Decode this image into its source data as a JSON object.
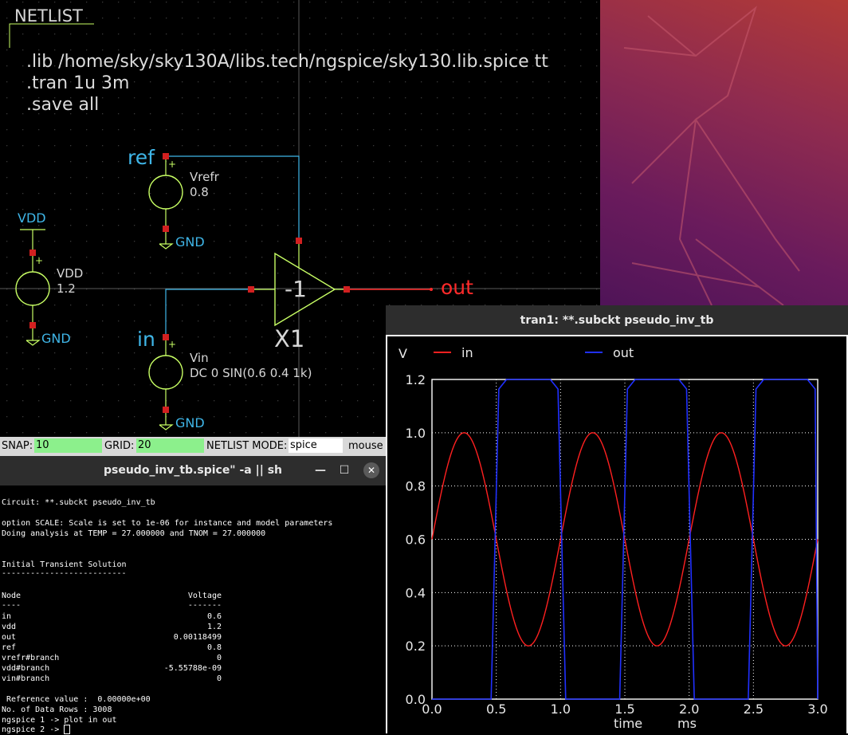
{
  "schematic": {
    "netlist_title": "NETLIST",
    "netlist_lines": [
      ".lib /home/sky/sky130A/libs.tech/ngspice/sky130.lib.spice tt",
      ".tran 1u 3m",
      ".save all"
    ],
    "vrefr": {
      "name": "Vrefr",
      "value": "0.8",
      "net": "ref",
      "gnd": "GND"
    },
    "vdd": {
      "label": "VDD",
      "name": "VDD",
      "value": "1.2",
      "gnd": "GND"
    },
    "vin": {
      "name": "Vin",
      "value": "DC 0 SIN(0.6 0.4 1k)",
      "net": "in",
      "gnd": "GND"
    },
    "inverter": {
      "gain": "-1",
      "instance": "X1"
    },
    "out_label": "out",
    "plus": "+"
  },
  "statusbar": {
    "snap_label": "SNAP:",
    "snap_value": "10",
    "grid_label": "GRID:",
    "grid_value": "20",
    "mode_label": "NETLIST MODE:",
    "mode_value": "spice",
    "mouse_label": "mouse"
  },
  "terminal": {
    "title": "pseudo_inv_tb.spice\" -a || sh",
    "minimize": "—",
    "maximize": "☐",
    "close": "✕",
    "lines": [
      "Circuit: **.subckt pseudo_inv_tb",
      "option SCALE: Scale is set to 1e-06 for instance and model parameters",
      "Doing analysis at TEMP = 27.000000 and TNOM = 27.000000",
      "Initial Transient Solution",
      "--------------------------",
      "Node",
      "----"
    ],
    "header_voltage": "Voltage",
    "header_dashes": "-------",
    "nodes": [
      {
        "node": "in",
        "value": "0.6"
      },
      {
        "node": "vdd",
        "value": "1.2"
      },
      {
        "node": "out",
        "value": "0.00118499"
      },
      {
        "node": "ref",
        "value": "0.8"
      },
      {
        "node": "vrefr#branch",
        "value": "0"
      },
      {
        "node": "vdd#branch",
        "value": "-5.55788e-09"
      },
      {
        "node": "vin#branch",
        "value": "0"
      }
    ],
    "footer": [
      " Reference value :  0.00000e+00",
      "No. of Data Rows : 3008",
      "ngspice 1 -> plot in out",
      "ngspice 2 -> "
    ]
  },
  "plot_window": {
    "title": "tran1: **.subckt pseudo_inv_tb",
    "ylabel": "V",
    "xlabel": "time",
    "xunit": "ms"
  },
  "chart_data": {
    "type": "line",
    "xlabel": "time",
    "xunit": "ms",
    "ylabel": "V",
    "xlim": [
      0,
      3.0
    ],
    "ylim": [
      0,
      1.2
    ],
    "xticks": [
      "0.0",
      "0.5",
      "1.0",
      "1.5",
      "2.0",
      "2.5",
      "3.0"
    ],
    "yticks": [
      "0.0",
      "0.2",
      "0.4",
      "0.6",
      "0.8",
      "1.0",
      "1.2"
    ],
    "grid": true,
    "legend": "top",
    "series": [
      {
        "name": "in",
        "color": "#ff2020",
        "function": "0.6 + 0.4*sin(2*pi*1k*t)",
        "offset": 0.6,
        "amplitude": 0.4,
        "frequency_khz": 1
      },
      {
        "name": "out",
        "color": "#2030ff",
        "high": 1.2,
        "low": 0.0,
        "rise_times_ms": [
          0.5,
          1.5,
          2.5
        ],
        "fall_times_ms": [
          1.0,
          2.0,
          3.0
        ]
      }
    ]
  },
  "colors": {
    "wire": "#c8ff64",
    "net_label": "#3fb6e8",
    "pin": "#d22020",
    "out_wire": "#ff2a2a",
    "grid_dot": "#3a3a3a",
    "crosshair": "#5a5a5a",
    "status_field": "#8cf08c"
  }
}
